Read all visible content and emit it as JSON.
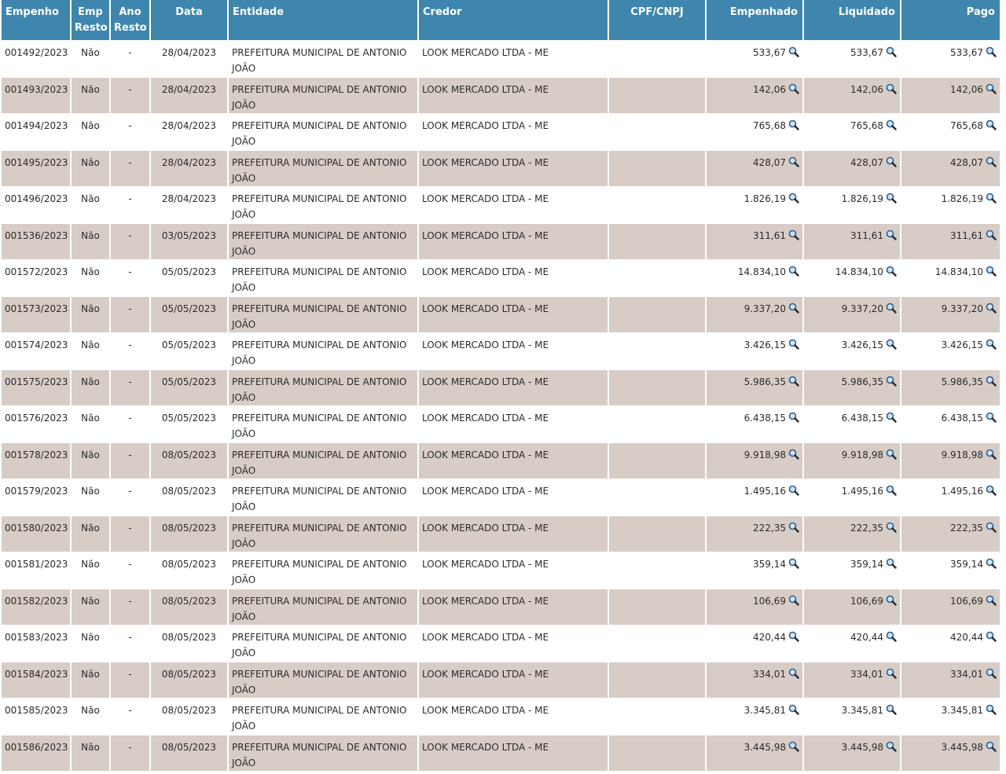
{
  "headers": {
    "empenho": "Empenho",
    "emp_resto": "Emp Resto",
    "ano_resto": "Ano Resto",
    "data": "Data",
    "entidade": "Entidade",
    "credor": "Credor",
    "cpf_cnpj": "CPF/CNPJ",
    "empenhado": "Empenhado",
    "liquidado": "Liquidado",
    "pago": "Pago"
  },
  "icons": {
    "detail": "magnifier-icon"
  },
  "colors": {
    "header_bg": "#3e86ad",
    "row_alt": "#d8ccc6"
  },
  "rows": [
    {
      "empenho": "001492/2023",
      "emp_resto": "Não",
      "ano_resto": "-",
      "data": "28/04/2023",
      "entidade": "PREFEITURA MUNICIPAL DE ANTONIO JOÃO",
      "credor": "LOOK MERCADO LTDA - ME",
      "cpf_cnpj": "",
      "empenhado": "533,67",
      "liquidado": "533,67",
      "pago": "533,67"
    },
    {
      "empenho": "001493/2023",
      "emp_resto": "Não",
      "ano_resto": "-",
      "data": "28/04/2023",
      "entidade": "PREFEITURA MUNICIPAL DE ANTONIO JOÃO",
      "credor": "LOOK MERCADO LTDA - ME",
      "cpf_cnpj": "",
      "empenhado": "142,06",
      "liquidado": "142,06",
      "pago": "142,06"
    },
    {
      "empenho": "001494/2023",
      "emp_resto": "Não",
      "ano_resto": "-",
      "data": "28/04/2023",
      "entidade": "PREFEITURA MUNICIPAL DE ANTONIO JOÃO",
      "credor": "LOOK MERCADO LTDA - ME",
      "cpf_cnpj": "",
      "empenhado": "765,68",
      "liquidado": "765,68",
      "pago": "765,68"
    },
    {
      "empenho": "001495/2023",
      "emp_resto": "Não",
      "ano_resto": "-",
      "data": "28/04/2023",
      "entidade": "PREFEITURA MUNICIPAL DE ANTONIO JOÃO",
      "credor": "LOOK MERCADO LTDA - ME",
      "cpf_cnpj": "",
      "empenhado": "428,07",
      "liquidado": "428,07",
      "pago": "428,07"
    },
    {
      "empenho": "001496/2023",
      "emp_resto": "Não",
      "ano_resto": "-",
      "data": "28/04/2023",
      "entidade": "PREFEITURA MUNICIPAL DE ANTONIO JOÃO",
      "credor": "LOOK MERCADO LTDA - ME",
      "cpf_cnpj": "",
      "empenhado": "1.826,19",
      "liquidado": "1.826,19",
      "pago": "1.826,19"
    },
    {
      "empenho": "001536/2023",
      "emp_resto": "Não",
      "ano_resto": "-",
      "data": "03/05/2023",
      "entidade": "PREFEITURA MUNICIPAL DE ANTONIO JOÃO",
      "credor": "LOOK MERCADO LTDA - ME",
      "cpf_cnpj": "",
      "empenhado": "311,61",
      "liquidado": "311,61",
      "pago": "311,61"
    },
    {
      "empenho": "001572/2023",
      "emp_resto": "Não",
      "ano_resto": "-",
      "data": "05/05/2023",
      "entidade": "PREFEITURA MUNICIPAL DE ANTONIO JOÃO",
      "credor": "LOOK MERCADO LTDA - ME",
      "cpf_cnpj": "",
      "empenhado": "14.834,10",
      "liquidado": "14.834,10",
      "pago": "14.834,10"
    },
    {
      "empenho": "001573/2023",
      "emp_resto": "Não",
      "ano_resto": "-",
      "data": "05/05/2023",
      "entidade": "PREFEITURA MUNICIPAL DE ANTONIO JOÃO",
      "credor": "LOOK MERCADO LTDA - ME",
      "cpf_cnpj": "",
      "empenhado": "9.337,20",
      "liquidado": "9.337,20",
      "pago": "9.337,20"
    },
    {
      "empenho": "001574/2023",
      "emp_resto": "Não",
      "ano_resto": "-",
      "data": "05/05/2023",
      "entidade": "PREFEITURA MUNICIPAL DE ANTONIO JOÃO",
      "credor": "LOOK MERCADO LTDA - ME",
      "cpf_cnpj": "",
      "empenhado": "3.426,15",
      "liquidado": "3.426,15",
      "pago": "3.426,15"
    },
    {
      "empenho": "001575/2023",
      "emp_resto": "Não",
      "ano_resto": "-",
      "data": "05/05/2023",
      "entidade": "PREFEITURA MUNICIPAL DE ANTONIO JOÃO",
      "credor": "LOOK MERCADO LTDA - ME",
      "cpf_cnpj": "",
      "empenhado": "5.986,35",
      "liquidado": "5.986,35",
      "pago": "5.986,35"
    },
    {
      "empenho": "001576/2023",
      "emp_resto": "Não",
      "ano_resto": "-",
      "data": "05/05/2023",
      "entidade": "PREFEITURA MUNICIPAL DE ANTONIO JOÃO",
      "credor": "LOOK MERCADO LTDA - ME",
      "cpf_cnpj": "",
      "empenhado": "6.438,15",
      "liquidado": "6.438,15",
      "pago": "6.438,15"
    },
    {
      "empenho": "001578/2023",
      "emp_resto": "Não",
      "ano_resto": "-",
      "data": "08/05/2023",
      "entidade": "PREFEITURA MUNICIPAL DE ANTONIO JOÃO",
      "credor": "LOOK MERCADO LTDA - ME",
      "cpf_cnpj": "",
      "empenhado": "9.918,98",
      "liquidado": "9.918,98",
      "pago": "9.918,98"
    },
    {
      "empenho": "001579/2023",
      "emp_resto": "Não",
      "ano_resto": "-",
      "data": "08/05/2023",
      "entidade": "PREFEITURA MUNICIPAL DE ANTONIO JOÃO",
      "credor": "LOOK MERCADO LTDA - ME",
      "cpf_cnpj": "",
      "empenhado": "1.495,16",
      "liquidado": "1.495,16",
      "pago": "1.495,16"
    },
    {
      "empenho": "001580/2023",
      "emp_resto": "Não",
      "ano_resto": "-",
      "data": "08/05/2023",
      "entidade": "PREFEITURA MUNICIPAL DE ANTONIO JOÃO",
      "credor": "LOOK MERCADO LTDA - ME",
      "cpf_cnpj": "",
      "empenhado": "222,35",
      "liquidado": "222,35",
      "pago": "222,35"
    },
    {
      "empenho": "001581/2023",
      "emp_resto": "Não",
      "ano_resto": "-",
      "data": "08/05/2023",
      "entidade": "PREFEITURA MUNICIPAL DE ANTONIO JOÃO",
      "credor": "LOOK MERCADO LTDA - ME",
      "cpf_cnpj": "",
      "empenhado": "359,14",
      "liquidado": "359,14",
      "pago": "359,14"
    },
    {
      "empenho": "001582/2023",
      "emp_resto": "Não",
      "ano_resto": "-",
      "data": "08/05/2023",
      "entidade": "PREFEITURA MUNICIPAL DE ANTONIO JOÃO",
      "credor": "LOOK MERCADO LTDA - ME",
      "cpf_cnpj": "",
      "empenhado": "106,69",
      "liquidado": "106,69",
      "pago": "106,69"
    },
    {
      "empenho": "001583/2023",
      "emp_resto": "Não",
      "ano_resto": "-",
      "data": "08/05/2023",
      "entidade": "PREFEITURA MUNICIPAL DE ANTONIO JOÃO",
      "credor": "LOOK MERCADO LTDA - ME",
      "cpf_cnpj": "",
      "empenhado": "420,44",
      "liquidado": "420,44",
      "pago": "420,44"
    },
    {
      "empenho": "001584/2023",
      "emp_resto": "Não",
      "ano_resto": "-",
      "data": "08/05/2023",
      "entidade": "PREFEITURA MUNICIPAL DE ANTONIO JOÃO",
      "credor": "LOOK MERCADO LTDA - ME",
      "cpf_cnpj": "",
      "empenhado": "334,01",
      "liquidado": "334,01",
      "pago": "334,01"
    },
    {
      "empenho": "001585/2023",
      "emp_resto": "Não",
      "ano_resto": "-",
      "data": "08/05/2023",
      "entidade": "PREFEITURA MUNICIPAL DE ANTONIO JOÃO",
      "credor": "LOOK MERCADO LTDA - ME",
      "cpf_cnpj": "",
      "empenhado": "3.345,81",
      "liquidado": "3.345,81",
      "pago": "3.345,81"
    },
    {
      "empenho": "001586/2023",
      "emp_resto": "Não",
      "ano_resto": "-",
      "data": "08/05/2023",
      "entidade": "PREFEITURA MUNICIPAL DE ANTONIO JOÃO",
      "credor": "LOOK MERCADO LTDA - ME",
      "cpf_cnpj": "",
      "empenhado": "3.445,98",
      "liquidado": "3.445,98",
      "pago": "3.445,98"
    }
  ]
}
